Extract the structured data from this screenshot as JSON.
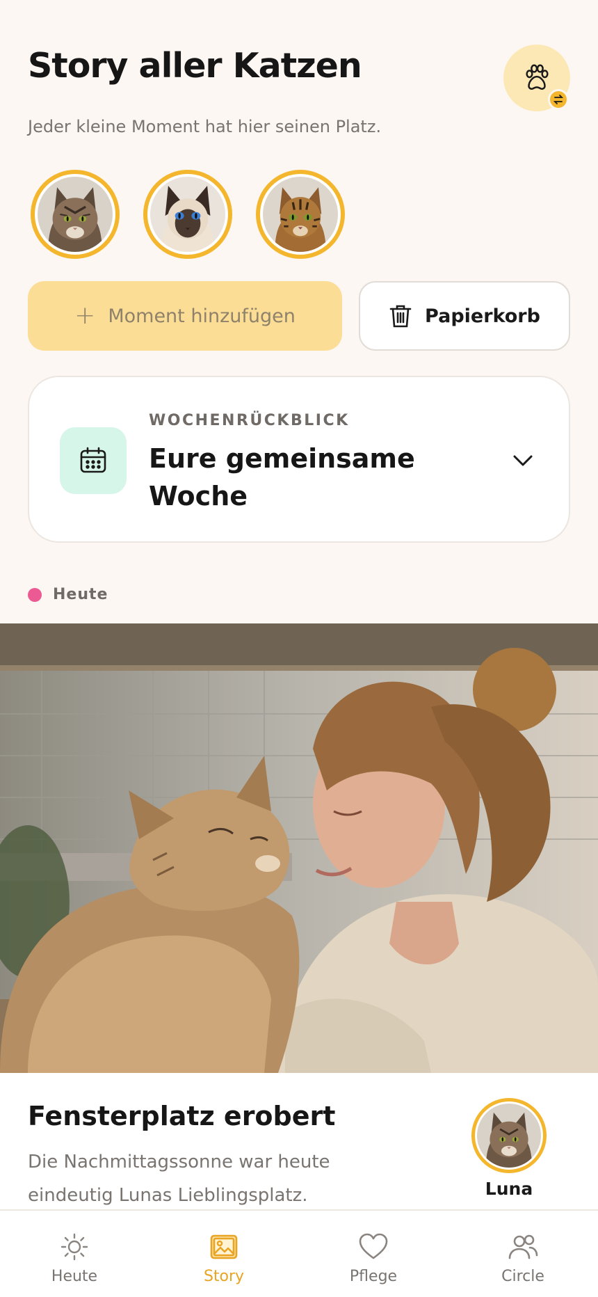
{
  "header": {
    "title": "Story aller Katzen",
    "subtitle": "Jeder kleine Moment hat hier seinen Platz.",
    "switch_icon": "paw-icon",
    "badge_icon": "swap-icon"
  },
  "cats": [
    {
      "name": "Luna",
      "fur": "#8a7058",
      "eyes": "#9aa83a"
    },
    {
      "name": "",
      "fur": "#efe4d4",
      "eyes": "#3b7fd4"
    },
    {
      "name": "",
      "fur": "#b0793c",
      "eyes": "#7d9a2e"
    }
  ],
  "actions": {
    "add_label": "Moment hinzufügen",
    "add_icon": "plus-icon",
    "trash_label": "Papierkorb",
    "trash_icon": "trash-icon"
  },
  "week_review": {
    "kicker": "WOCHENRÜCKBLICK",
    "title": "Eure gemeinsame Woche",
    "icon": "calendar-icon",
    "toggle_icon": "chevron-down-icon"
  },
  "timeline": {
    "day_label": "Heute"
  },
  "moment": {
    "title": "Fensterplatz erobert",
    "description": "Die Nachmittagssonne war heute eindeutig Lunas Lieblingsplatz.",
    "cat_name": "Luna"
  },
  "nav": {
    "items": [
      {
        "label": "Heute",
        "icon": "sun-icon",
        "active": false
      },
      {
        "label": "Story",
        "icon": "gallery-icon",
        "active": true
      },
      {
        "label": "Pflege",
        "icon": "heart-icon",
        "active": false
      },
      {
        "label": "Circle",
        "icon": "people-icon",
        "active": false
      }
    ]
  },
  "colors": {
    "background": "#fdf7f3",
    "accent": "#f4b62d",
    "accent_active": "#e8a422",
    "add_button": "#fbdd96",
    "calendar_tile": "#d6f6ea",
    "today_dot": "#ec5a93"
  }
}
